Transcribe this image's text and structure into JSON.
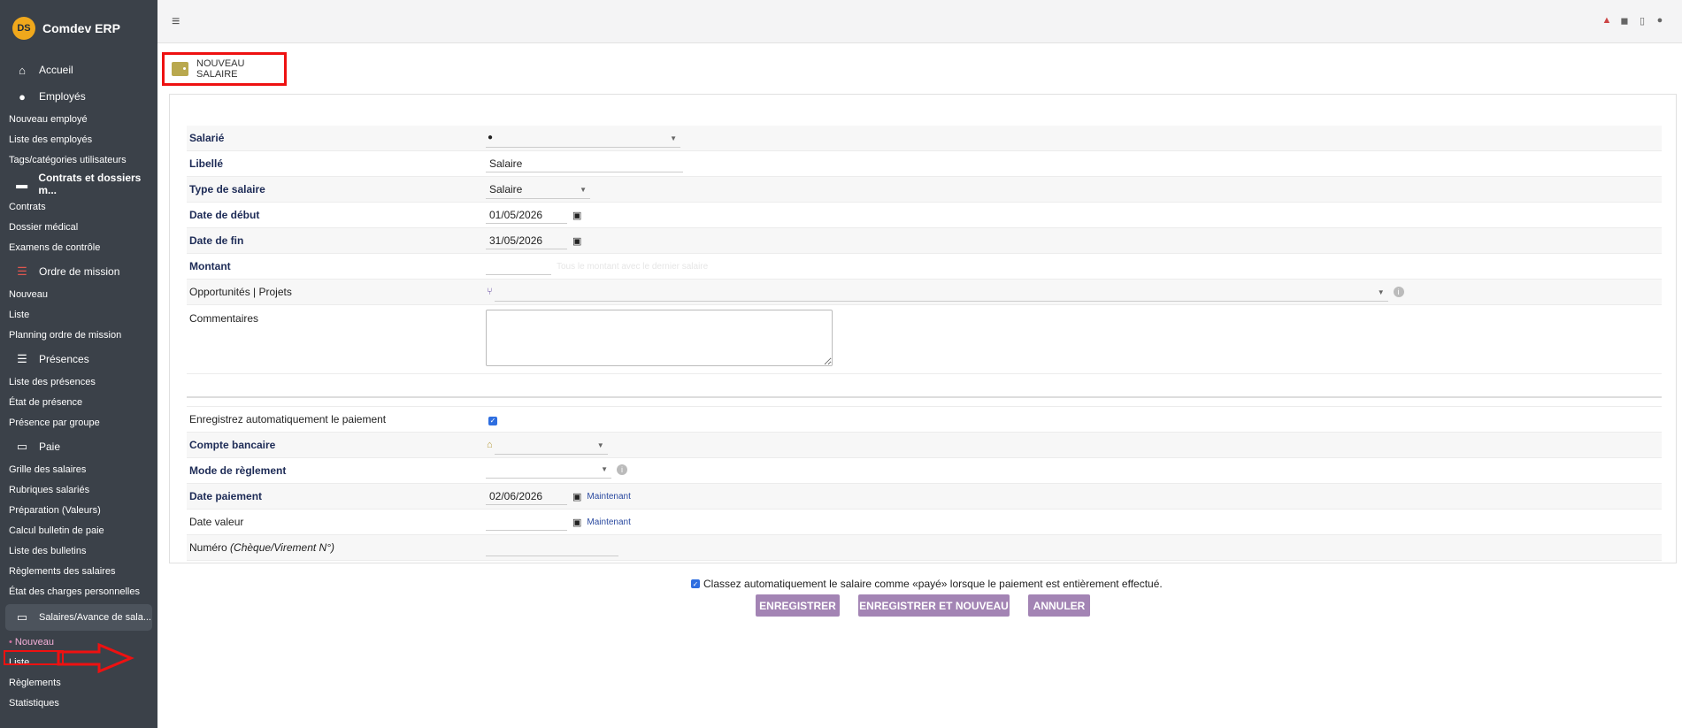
{
  "app": {
    "brand": "Comdev ERP",
    "logo_text": "DS"
  },
  "sidebar": {
    "accueil": "Accueil",
    "employes": "Employés",
    "employes_items": [
      "Nouveau employé",
      "Liste des employés",
      "Tags/catégories utilisateurs"
    ],
    "contrats": "Contrats et dossiers m...",
    "contrats_items": [
      "Contrats",
      "Dossier médical",
      "Examens de contrôle"
    ],
    "ordre": "Ordre de mission",
    "ordre_items": [
      "Nouveau",
      "Liste",
      "Planning ordre de mission"
    ],
    "presences": "Présences",
    "presences_items": [
      "Liste des présences",
      "État de présence",
      "Présence par groupe"
    ],
    "paie": "Paie",
    "paie_items": [
      "Grille des salaires",
      "Rubriques salariés",
      "Préparation (Valeurs)",
      "Calcul bulletin de paie",
      "Liste des bulletins",
      "Règlements des salaires",
      "État des charges personnelles"
    ],
    "salaires": "Salaires/Avance de sala...",
    "salaires_items": [
      "Nouveau",
      "Liste",
      "Règlements",
      "Statistiques"
    ]
  },
  "page": {
    "title": "NOUVEAU SALAIRE"
  },
  "form": {
    "salarie_label": "Salarié",
    "libelle_label": "Libellé",
    "libelle_value": "Salaire",
    "type_label": "Type de salaire",
    "type_value": "Salaire",
    "date_debut_label": "Date de début",
    "date_debut_value": "01/05/2026",
    "date_fin_label": "Date de fin",
    "date_fin_value": "31/05/2026",
    "montant_label": "Montant",
    "montant_hint": "Tous le montant avec le dernier salaire",
    "opportunites_label": "Opportunités | Projets",
    "commentaires_label": "Commentaires",
    "auto_paiement_label": "Enregistrez automatiquement le paiement",
    "compte_label": "Compte bancaire",
    "mode_label": "Mode de règlement",
    "date_paiement_label": "Date paiement",
    "date_paiement_value": "02/06/2026",
    "maintenant": "Maintenant",
    "date_valeur_label": "Date valeur",
    "numero_label": "Numéro",
    "numero_hint": "(Chèque/Virement N°)"
  },
  "footer": {
    "auto_paid_label": "Classez automatiquement le salaire comme «payé» lorsque le paiement est entièrement effectué.",
    "save": "ENREGISTRER",
    "save_new": "ENREGISTRER ET NOUVEAU",
    "cancel": "ANNULER"
  },
  "colors": {
    "sidebar_bg": "#3b4149",
    "button": "#a384b4",
    "highlight": "#e11111"
  }
}
